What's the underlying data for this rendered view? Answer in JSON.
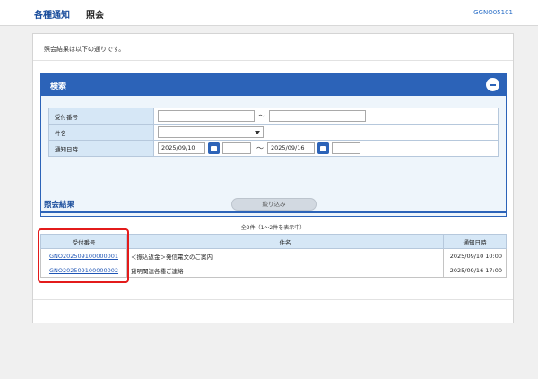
{
  "header": {
    "app_title": "各種通知",
    "page_title": "照会",
    "screen_id": "GGNO05101"
  },
  "intro_text": "照会結果は以下の通りです。",
  "search": {
    "title": "検索",
    "fields": {
      "receipt_label": "受付番号",
      "subject_label": "件名",
      "notice_date_label": "通知日時",
      "range_sep": "～",
      "date_from": "2025/09/10",
      "date_to": "2025/09/16"
    },
    "filter_button": "絞り込み"
  },
  "results": {
    "title": "照会結果",
    "count_text": "全2件（1～2件を表示中）",
    "columns": [
      "受付番号",
      "件名",
      "通知日時"
    ],
    "rows": [
      {
        "receipt": "GNO202509100000001",
        "subject": "＜振込返金＞発信電文のご案内",
        "datetime": "2025/09/10 10:00"
      },
      {
        "receipt": "GNO202509100000002",
        "subject": "貸明関連各種ご連絡",
        "datetime": "2025/09/16 17:00"
      }
    ]
  },
  "colors": {
    "accent": "#2c63b8",
    "highlight": "#e31b1b"
  }
}
